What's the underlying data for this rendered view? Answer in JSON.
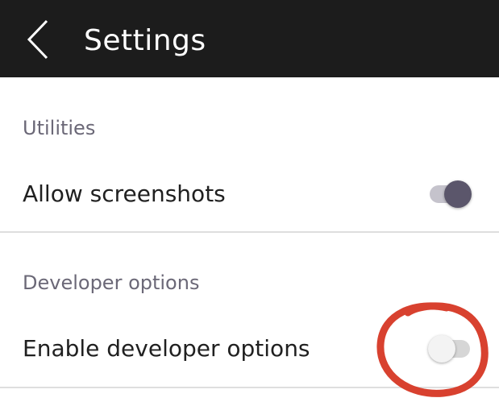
{
  "header": {
    "title": "Settings",
    "back_icon": "chevron-left-icon"
  },
  "sections": [
    {
      "title": "Utilities",
      "items": [
        {
          "label": "Allow screenshots",
          "enabled": true
        }
      ]
    },
    {
      "title": "Developer options",
      "items": [
        {
          "label": "Enable developer options",
          "enabled": false
        }
      ]
    }
  ],
  "colors": {
    "app_bar": "#1c1c1c",
    "toggle_on_thumb": "#5b566b",
    "annotation": "#d8412f"
  }
}
